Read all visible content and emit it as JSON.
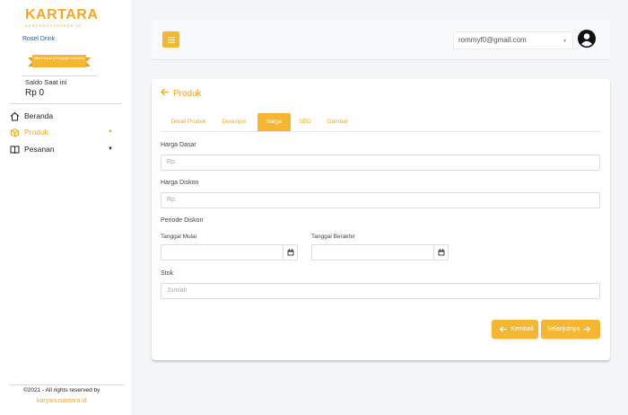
{
  "brand": {
    "name": "KARTARA",
    "tagline": "KARYANUSANTARA.ID",
    "ribbon_text": "Mitra Penjual & Pengrajin Nusantara"
  },
  "sidebar": {
    "store_name": "Rosel Drink",
    "saldo_label": "Saldo Saat ini",
    "saldo_value": "Rp 0",
    "items": [
      {
        "label": "Beranda",
        "icon": "home-icon",
        "active": false
      },
      {
        "label": "Produk",
        "icon": "box-icon",
        "active": true
      },
      {
        "label": "Pesanan",
        "icon": "book-icon",
        "active": false
      }
    ],
    "footer_copyright": "©2021 - All rights reserved by",
    "footer_link": "karyanusantara.id"
  },
  "topbar": {
    "menu_icon": "hamburger-icon",
    "user_email": "rommyf0@gmail.com",
    "avatar_icon": "user-avatar-icon"
  },
  "page": {
    "title": "Produk",
    "tabs": [
      {
        "label": "Detail Produk",
        "active": false
      },
      {
        "label": "Deskripsi",
        "active": false
      },
      {
        "label": "Harga",
        "active": true
      },
      {
        "label": "SEO",
        "active": false
      },
      {
        "label": "Gambar",
        "active": false
      }
    ],
    "form": {
      "harga_dasar_label": "Harga Dasar",
      "harga_dasar_placeholder": "Rp.",
      "harga_diskon_label": "Harga Diskon",
      "harga_diskon_placeholder": "Rp.",
      "periode_label": "Periode Diskon",
      "tanggal_mulai_label": "Tanggal Mulai",
      "tanggal_berakhir_label": "Tanggal Berakhir",
      "stok_label": "Stok",
      "stok_placeholder": "Jumlah"
    },
    "buttons": {
      "back": "Kembali",
      "next": "Selanjutnya"
    }
  },
  "colors": {
    "accent": "#f5b731",
    "accent_text": "#f5a623",
    "link": "#2c5aa0"
  }
}
